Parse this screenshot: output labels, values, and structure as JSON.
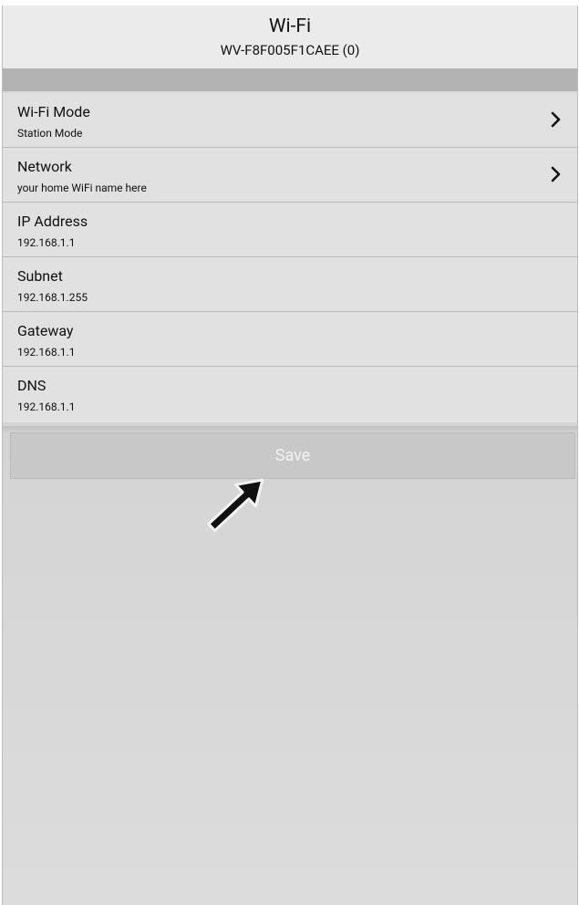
{
  "header": {
    "title": "Wi-Fi",
    "subtitle": "WV-F8F005F1CAEE (0)"
  },
  "settings": [
    {
      "label": "Wi-Fi Mode",
      "value": "Station Mode",
      "has_chevron": true
    },
    {
      "label": "Network",
      "value": "your home WiFi name here",
      "has_chevron": true
    },
    {
      "label": "IP Address",
      "value": "192.168.1.1",
      "has_chevron": false
    },
    {
      "label": "Subnet",
      "value": "192.168.1.255",
      "has_chevron": false
    },
    {
      "label": "Gateway",
      "value": "192.168.1.1",
      "has_chevron": false
    },
    {
      "label": "DNS",
      "value": "192.168.1.1",
      "has_chevron": false
    }
  ],
  "save_button": {
    "label": "Save",
    "enabled": false
  },
  "icons": {
    "row_chevron": "chevron-right-icon",
    "annotation": "pointer-arrow-icon"
  },
  "colors": {
    "header_bg": "#ebebeb",
    "row_bg": "#e1e1e1",
    "save_button_bg": "#c8c8c8",
    "save_label": "#f2f2f2"
  }
}
